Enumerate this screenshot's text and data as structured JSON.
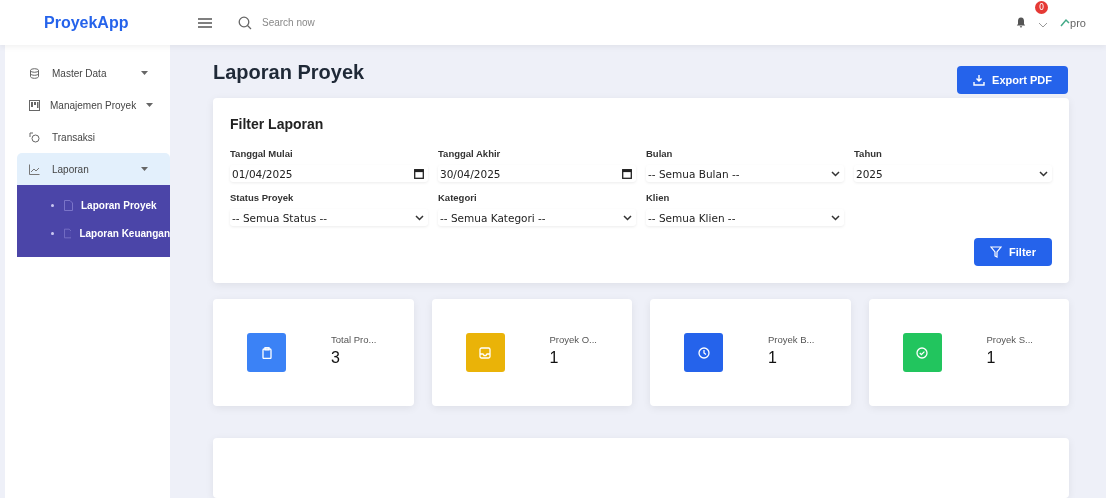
{
  "header": {
    "brand": "ProyekApp",
    "search": {
      "placeholder": "Search now"
    },
    "notification_badge": "0",
    "profile_alt": "pro"
  },
  "sidebar": {
    "items": [
      {
        "label": "Master Data",
        "has_caret": true,
        "selected": false
      },
      {
        "label": "Manajemen Proyek",
        "has_caret": true,
        "selected": false
      },
      {
        "label": "Transaksi",
        "has_caret": false,
        "selected": false
      },
      {
        "label": "Laporan",
        "has_caret": true,
        "selected": true,
        "children": [
          {
            "label": "Laporan Proyek"
          },
          {
            "label": "Laporan Keuangan"
          }
        ]
      }
    ]
  },
  "page": {
    "title": "Laporan Proyek",
    "export_button": "Export PDF"
  },
  "filter": {
    "title": "Filter Laporan",
    "fields": [
      {
        "label": "Tanggal Mulai",
        "kind": "date",
        "value": "01/04/2025"
      },
      {
        "label": "Tanggal Akhir",
        "kind": "date",
        "value": "30/04/2025"
      },
      {
        "label": "Bulan",
        "kind": "select",
        "value": "-- Semua Bulan --"
      },
      {
        "label": "Tahun",
        "kind": "select",
        "value": "2025"
      },
      {
        "label": "Status Proyek",
        "kind": "select",
        "value": "-- Semua Status --"
      },
      {
        "label": "Kategori",
        "kind": "select",
        "value": "-- Semua Kategori --"
      },
      {
        "label": "Klien",
        "kind": "select",
        "value": "-- Semua Klien --"
      }
    ],
    "button": "Filter"
  },
  "stats": [
    {
      "label": "Total Pro...",
      "value": "3",
      "color": "#3b82f6"
    },
    {
      "label": "Proyek O...",
      "value": "1",
      "color": "#eab308"
    },
    {
      "label": "Proyek B...",
      "value": "1",
      "color": "#2563eb"
    },
    {
      "label": "Proyek S...",
      "value": "1",
      "color": "#22c55e"
    }
  ]
}
